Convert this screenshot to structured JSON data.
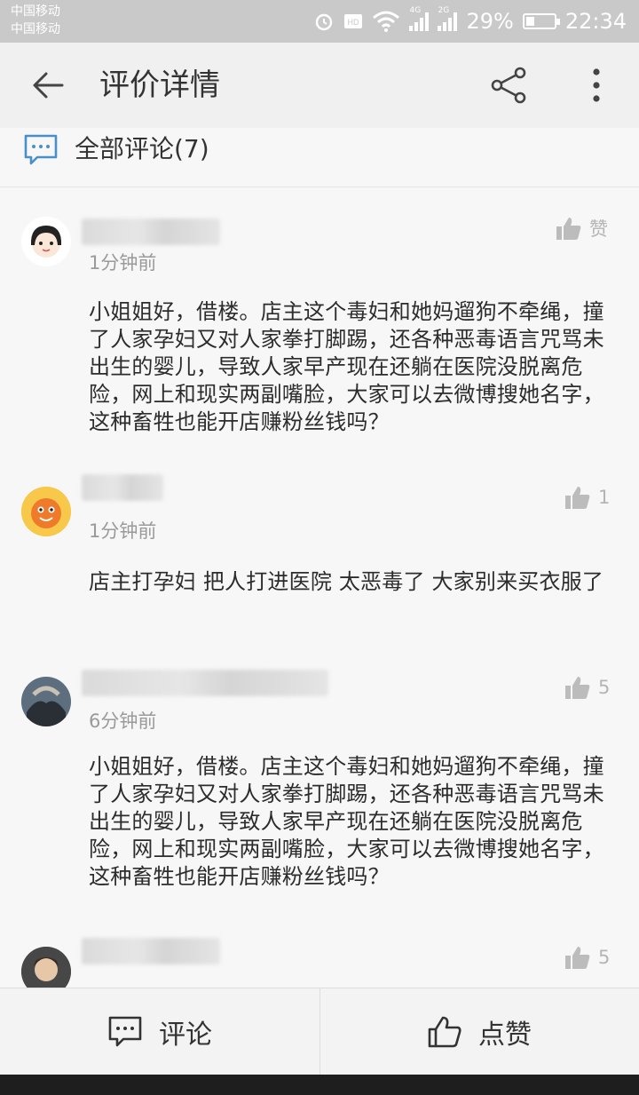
{
  "status_bar": {
    "carrier_1": "中国移动",
    "carrier_2": "中国移动",
    "signal_1": "4G",
    "signal_2": "2G",
    "battery": "29%",
    "time": "22:34"
  },
  "header": {
    "back_icon": "arrow-left-icon",
    "title": "评价详情",
    "share_icon": "share-icon",
    "more_icon": "more-vertical-icon"
  },
  "comments_header": {
    "icon": "comment-icon",
    "label": "全部评论(7)"
  },
  "comments": [
    {
      "time": "1分钟前",
      "like_label": "赞",
      "text": "小姐姐好，借楼。店主这个毒妇和她妈遛狗不牵绳，撞了人家孕妇又对人家拳打脚踢，还各种恶毒语言咒骂未出生的婴儿，导致人家早产现在还躺在医院没脱离危险，网上和现实两副嘴脸，大家可以去微博搜她名字，这种畜牲也能开店赚粉丝钱吗？"
    },
    {
      "time": "1分钟前",
      "like_label": "1",
      "text": "店主打孕妇 把人打进医院 太恶毒了 大家别来买衣服了"
    },
    {
      "time": "6分钟前",
      "like_label": "5",
      "text": "小姐姐好，借楼。店主这个毒妇和她妈遛狗不牵绳，撞了人家孕妇又对人家拳打脚踢，还各种恶毒语言咒骂未出生的婴儿，导致人家早产现在还躺在医院没脱离危险，网上和现实两副嘴脸，大家可以去微博搜她名字，这种畜牲也能开店赚粉丝钱吗？"
    },
    {
      "time": "",
      "like_label": "5",
      "text": ""
    }
  ],
  "bottom_bar": {
    "comment_label": "评论",
    "like_label": "点赞"
  }
}
